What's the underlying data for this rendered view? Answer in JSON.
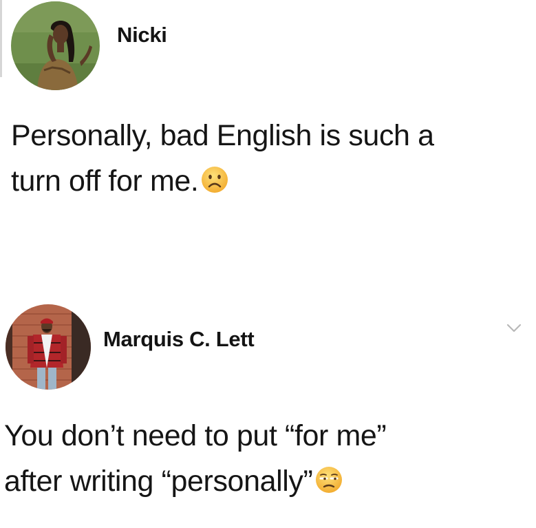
{
  "posts": [
    {
      "author": "Nicki",
      "text_lines": [
        "Personally, bad English is such a",
        "turn off for me."
      ],
      "emoji": "frowning-face-emoji"
    },
    {
      "author": "Marquis C. Lett",
      "text_lines": [
        "You don’t need to put “for me”",
        "after writing “personally”"
      ],
      "emoji": "unamused-face-emoji",
      "menu_icon": "chevron-down-icon"
    }
  ],
  "colors": {
    "background": "#ffffff",
    "text": "#151515",
    "emoji_yellow": "#f7c436",
    "chevron": "#b8b8b8"
  }
}
